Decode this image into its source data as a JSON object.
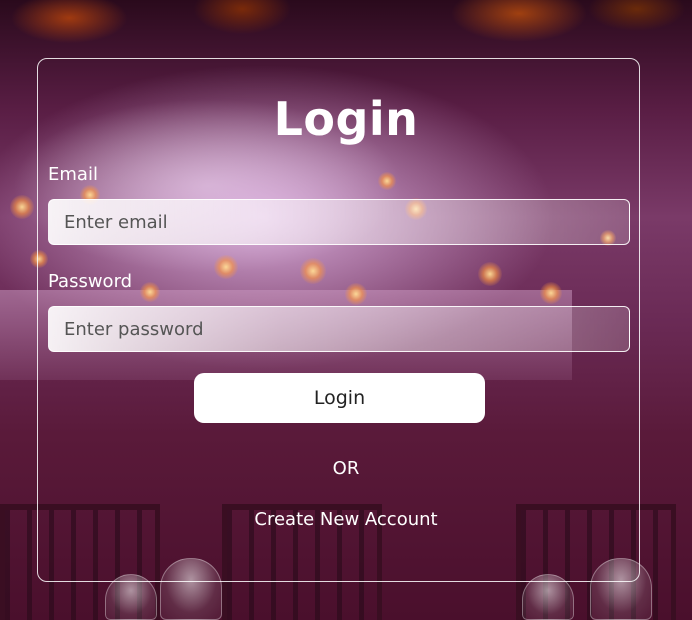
{
  "login_form": {
    "title": "Login",
    "email": {
      "label": "Email",
      "placeholder": "Enter email",
      "value": ""
    },
    "password": {
      "label": "Password",
      "placeholder": "Enter password",
      "value": ""
    },
    "submit_label": "Login",
    "divider_text": "OR",
    "create_account_label": "Create New Account"
  },
  "colors": {
    "text": "#ffffff",
    "button_bg": "#ffffff",
    "button_text": "#222222",
    "card_border": "#ffffff"
  }
}
